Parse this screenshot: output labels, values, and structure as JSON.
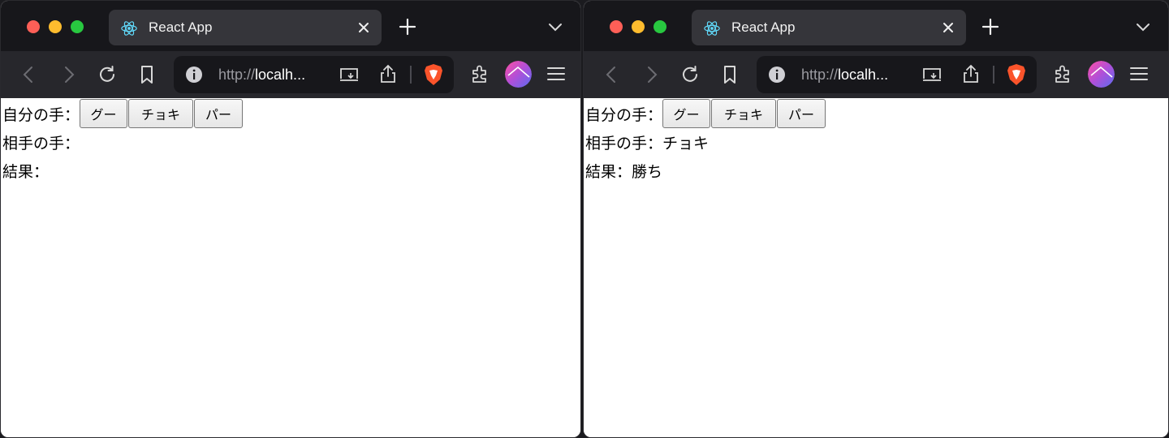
{
  "windows": [
    {
      "tab": {
        "title": "React App"
      },
      "url": {
        "scheme": "http://",
        "host": "localh..."
      },
      "app": {
        "my_hand_label": "自分の手：",
        "buttons": [
          "グー",
          "チョキ",
          "パー"
        ],
        "opponent_label": "相手の手：",
        "opponent_value": "",
        "result_label": "結果：",
        "result_value": ""
      }
    },
    {
      "tab": {
        "title": "React App"
      },
      "url": {
        "scheme": "http://",
        "host": "localh..."
      },
      "app": {
        "my_hand_label": "自分の手：",
        "buttons": [
          "グー",
          "チョキ",
          "パー"
        ],
        "opponent_label": "相手の手：",
        "opponent_value": "チョキ",
        "result_label": "結果：",
        "result_value": "勝ち"
      }
    }
  ],
  "colors": {
    "close": "#fe5f57",
    "minimize": "#febc2e",
    "zoom": "#28c840",
    "brave": "#fb542b"
  }
}
